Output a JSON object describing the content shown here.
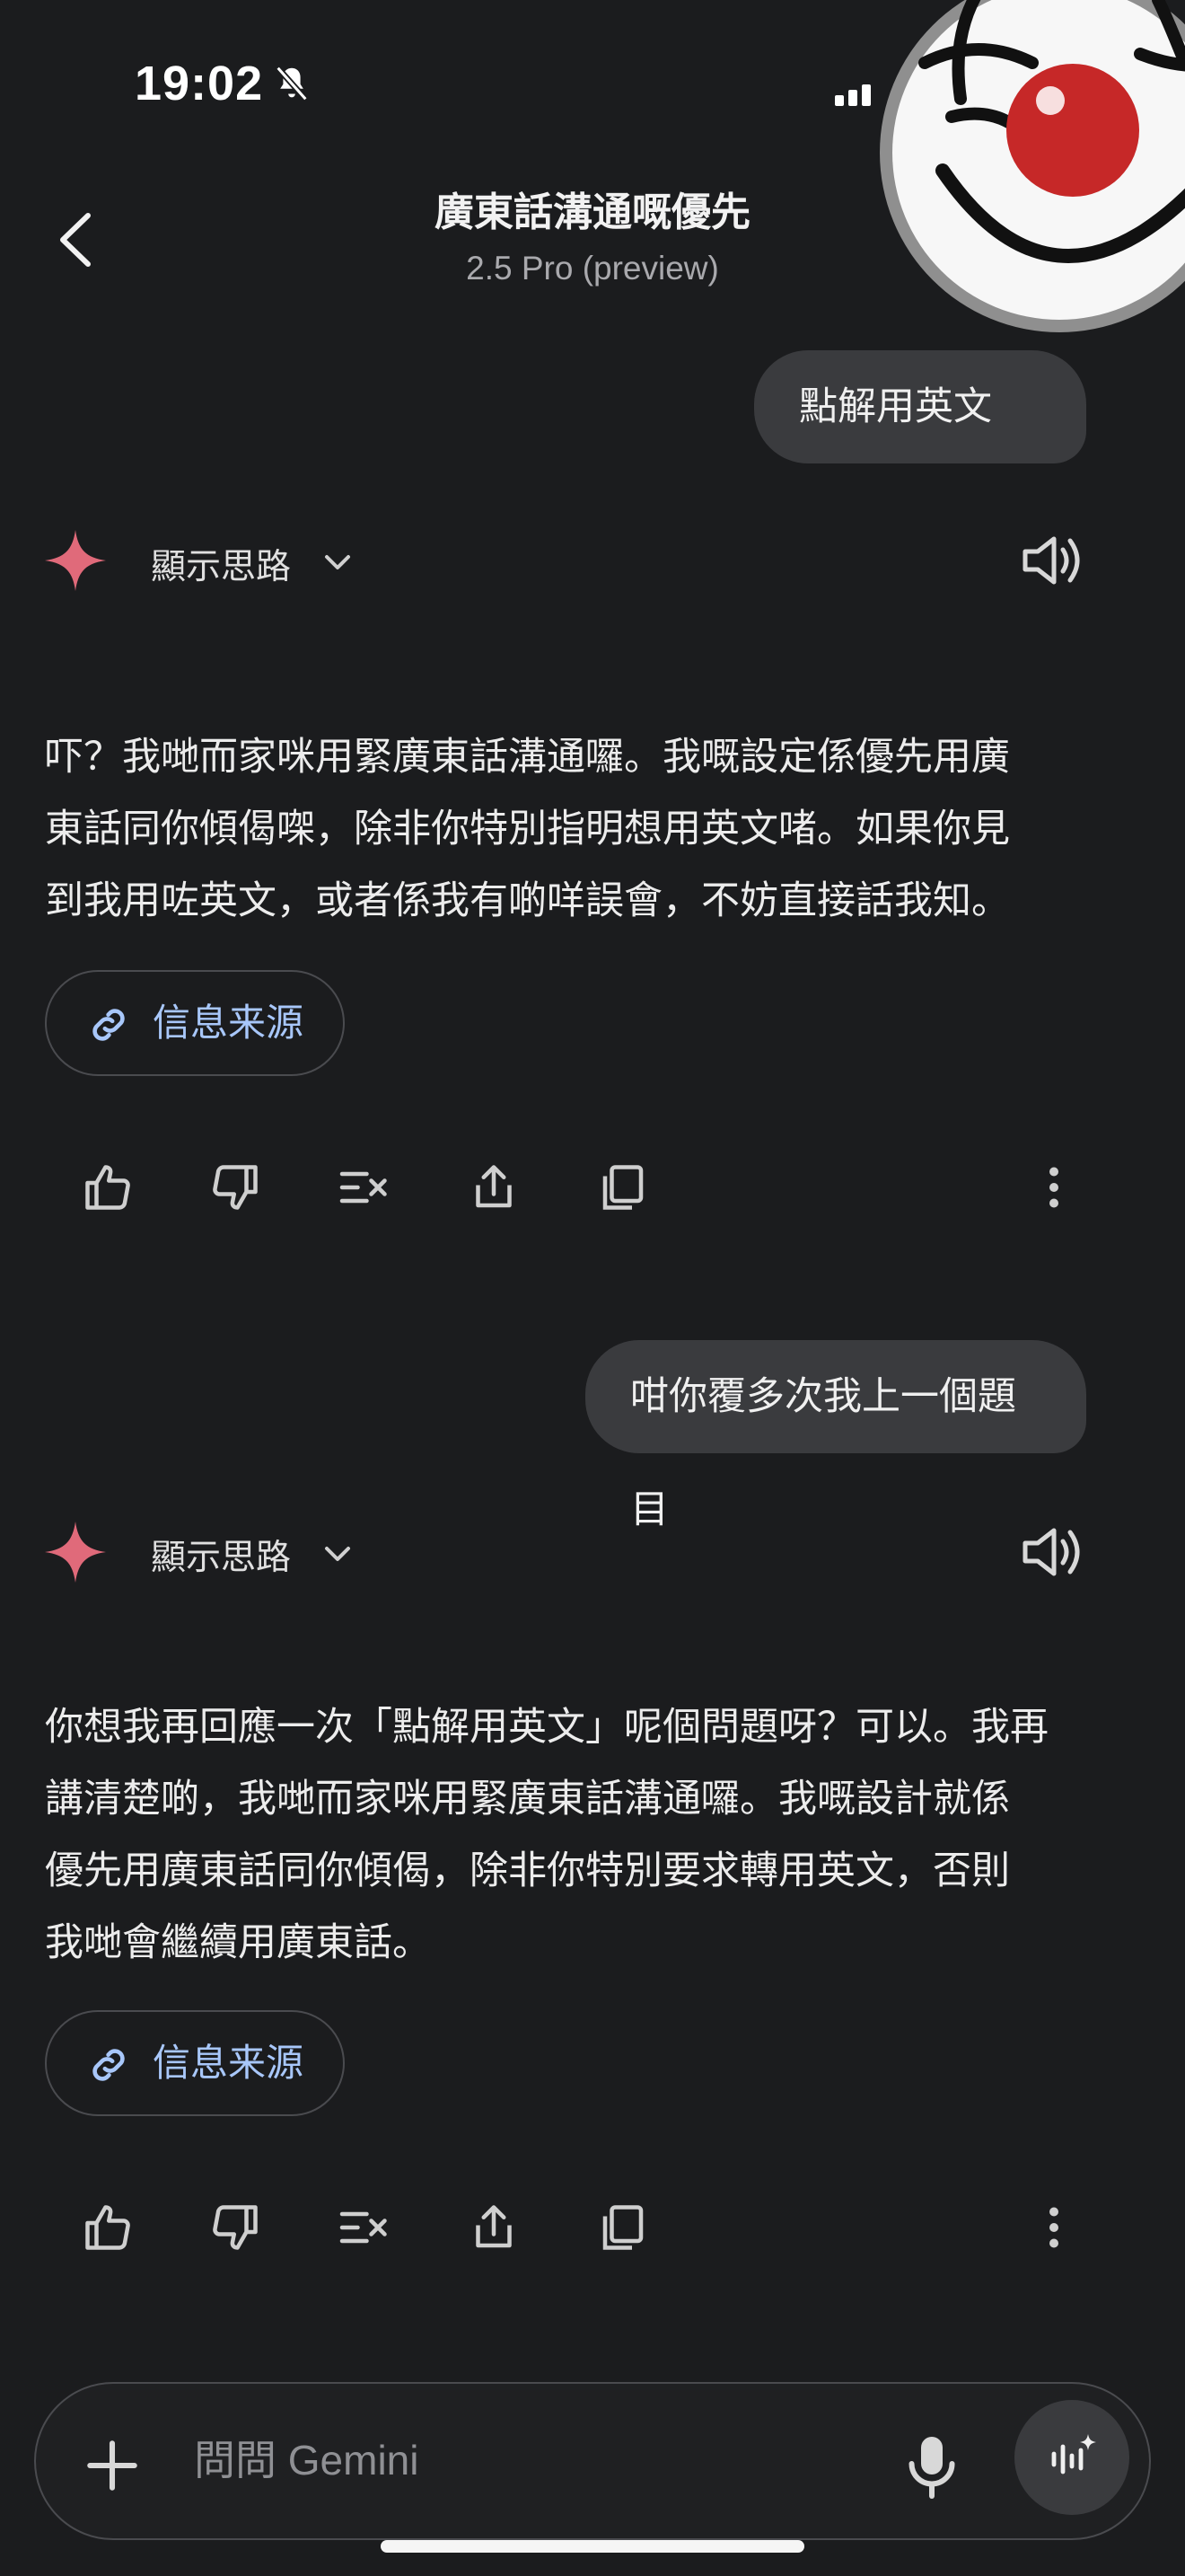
{
  "status_bar": {
    "time": "19:02"
  },
  "header": {
    "title": "廣東話溝通嘅優先",
    "model": "2.5 Pro (preview)"
  },
  "conversation": {
    "user_msg_1": "點解用英文",
    "thoughts_1": "顯示思路",
    "reply_1": [
      "吓？我哋而家咪用緊廣東話溝通囉。我嘅設定係優先用廣",
      "東話同你傾偈㗎，除非你特別指明想用英文啫。如果你見",
      "到我用咗英文，或者係我有啲咩誤會，不妨直接話我知。"
    ],
    "sources_1": "信息来源",
    "user_msg_2": "咁你覆多次我上一個題目",
    "thoughts_2": "顯示思路",
    "reply_2": [
      "你想我再回應一次「點解用英文」呢個問題呀？可以。我再",
      "講清楚啲，我哋而家咪用緊廣東話溝通囉。我嘅設計就係",
      "優先用廣東話同你傾偈，除非你特別要求轉用英文，否則",
      "我哋會繼續用廣東話。"
    ],
    "sources_2": "信息来源"
  },
  "input": {
    "placeholder": "問問 Gemini"
  },
  "icons": [
    "bell-off-icon",
    "signal-icon",
    "back-icon",
    "avatar-clown",
    "gemini-star-icon",
    "chevron-down-icon",
    "speaker-icon",
    "link-icon",
    "thumbs-up-icon",
    "thumbs-down-icon",
    "modify-icon",
    "share-icon",
    "copy-icon",
    "more-icon",
    "plus-icon",
    "mic-icon",
    "live-icon"
  ],
  "colors": {
    "background": "#1b1c1e",
    "bubble": "#3a3b3e",
    "link": "#a8c7fa",
    "star": "#e06a7a"
  }
}
